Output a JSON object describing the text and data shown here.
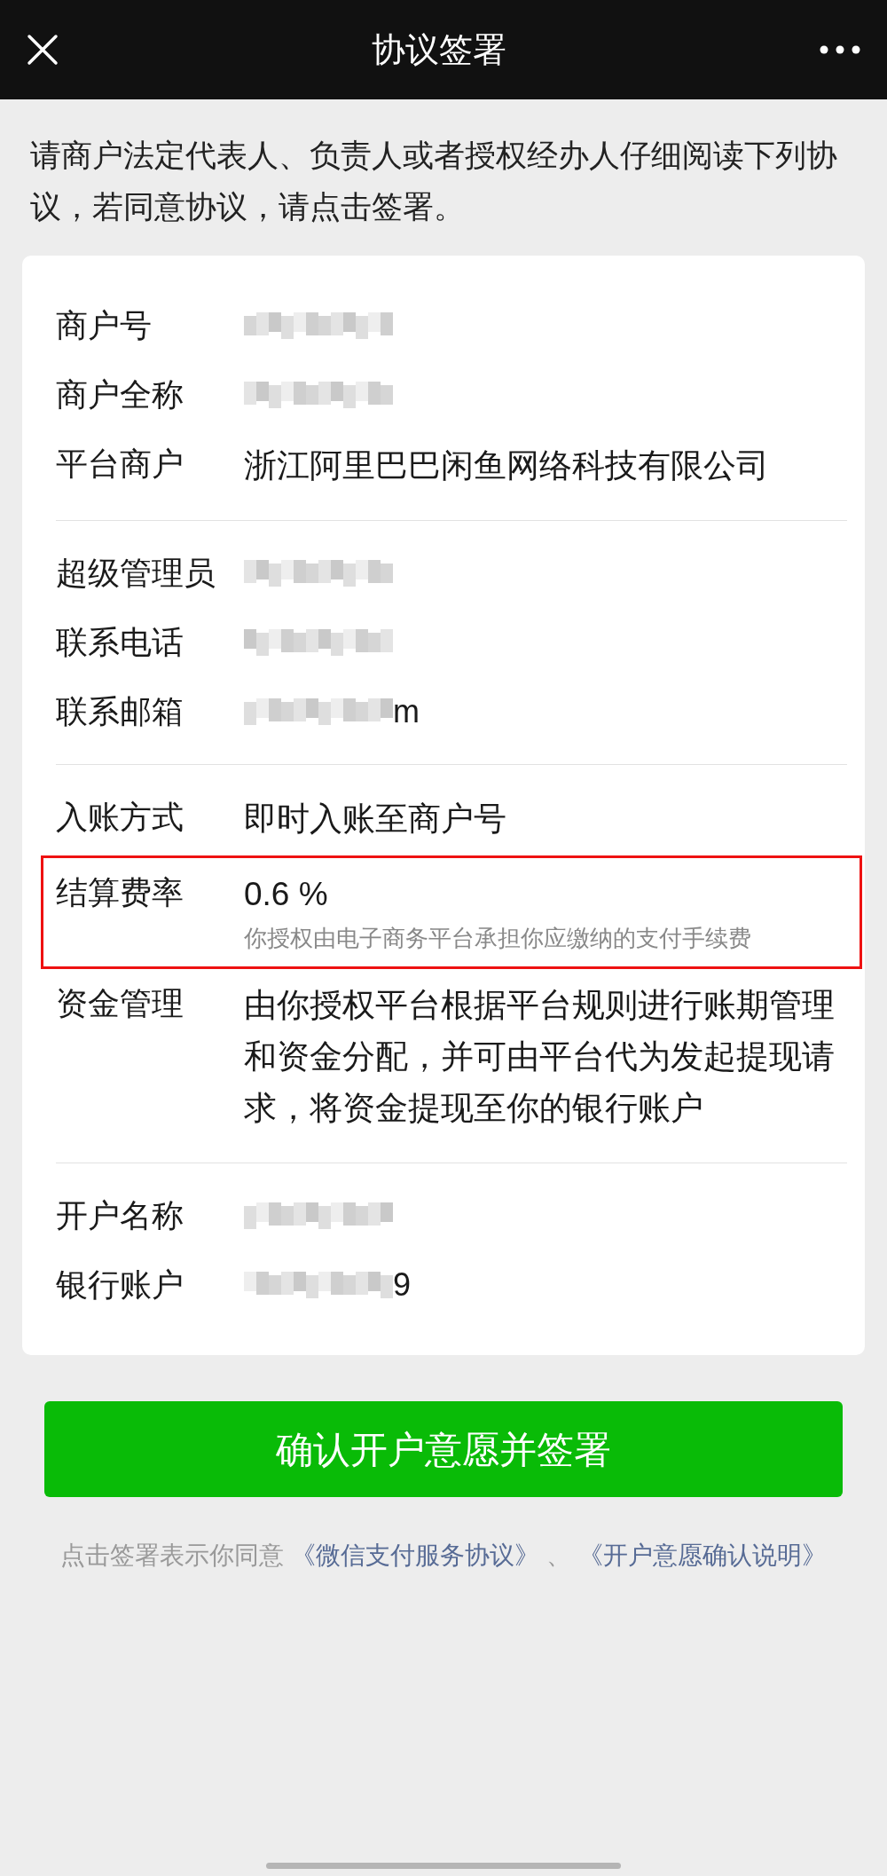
{
  "header": {
    "title": "协议签署"
  },
  "intro": "请商户法定代表人、负责人或者授权经办人仔细阅读下列协议，若同意协议，请点击签署。",
  "sections": [
    {
      "rows": [
        {
          "label": "商户号",
          "redacted": true,
          "highlighted": false
        },
        {
          "label": "商户全称",
          "redacted": true,
          "highlighted": false
        },
        {
          "label": "平台商户",
          "value": "浙江阿里巴巴闲鱼网络科技有限公司",
          "redacted": false,
          "highlighted": false
        }
      ]
    },
    {
      "rows": [
        {
          "label": "超级管理员",
          "redacted": true,
          "highlighted": false
        },
        {
          "label": "联系电话",
          "redacted": true,
          "highlighted": false
        },
        {
          "label": "联系邮箱",
          "redacted": true,
          "value_suffix": "m",
          "highlighted": false
        }
      ]
    },
    {
      "rows": [
        {
          "label": "入账方式",
          "value": "即时入账至商户号",
          "redacted": false,
          "highlighted": false
        },
        {
          "label": "结算费率",
          "value": "0.6 %",
          "note": "你授权由电子商务平台承担你应缴纳的支付手续费",
          "redacted": false,
          "highlighted": true
        },
        {
          "label": "资金管理",
          "value": "由你授权平台根据平台规则进行账期管理和资金分配，并可由平台代为发起提现请求，将资金提现至你的银行账户",
          "redacted": false,
          "highlighted": false
        }
      ]
    },
    {
      "rows": [
        {
          "label": "开户名称",
          "redacted": true,
          "highlighted": false
        },
        {
          "label": "银行账户",
          "redacted": true,
          "value_suffix": "9",
          "highlighted": false
        }
      ]
    }
  ],
  "confirm_button": "确认开户意愿并签署",
  "footer": {
    "text": "点击签署表示你同意",
    "links": [
      "《微信支付服务协议》",
      "《开户意愿确认说明》"
    ],
    "separator": "、"
  }
}
